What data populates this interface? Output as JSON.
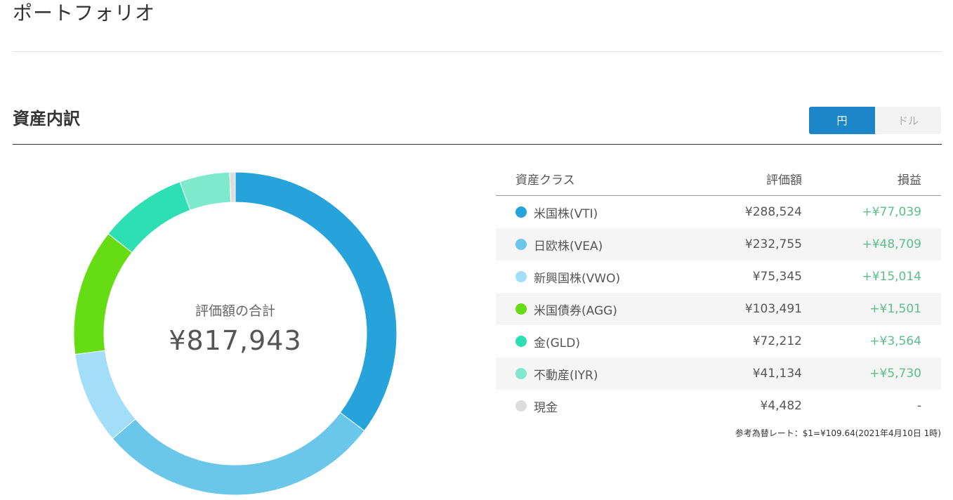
{
  "page": {
    "title": "ポートフォリオ"
  },
  "section": {
    "title": "資産内訳"
  },
  "currency_toggle": {
    "yen": "円",
    "dollar": "ドル",
    "selected": "円"
  },
  "donut": {
    "label": "評価額の合計",
    "total": "¥817,943"
  },
  "table": {
    "headers": {
      "name": "資産クラス",
      "value": "評価額",
      "gain": "損益"
    },
    "rows": [
      {
        "name": "米国株(VTI)",
        "value": "¥288,524",
        "gain": "+¥77,039",
        "color": "#27a3db"
      },
      {
        "name": "日欧株(VEA)",
        "value": "¥232,755",
        "gain": "+¥48,709",
        "color": "#6bc7ea"
      },
      {
        "name": "新興国株(VWO)",
        "value": "¥75,345",
        "gain": "+¥15,014",
        "color": "#a3def8"
      },
      {
        "name": "米国債券(AGG)",
        "value": "¥103,491",
        "gain": "+¥1,501",
        "color": "#65dc14"
      },
      {
        "name": "金(GLD)",
        "value": "¥72,212",
        "gain": "+¥3,564",
        "color": "#2ddfb2"
      },
      {
        "name": "不動産(IYR)",
        "value": "¥41,134",
        "gain": "+¥5,730",
        "color": "#7fe9cd"
      },
      {
        "name": "現金",
        "value": "¥4,482",
        "gain": "-",
        "color": "#dddddd"
      }
    ]
  },
  "note": "参考為替レート：$1=¥109.64(2021年4月10日 1時)"
}
